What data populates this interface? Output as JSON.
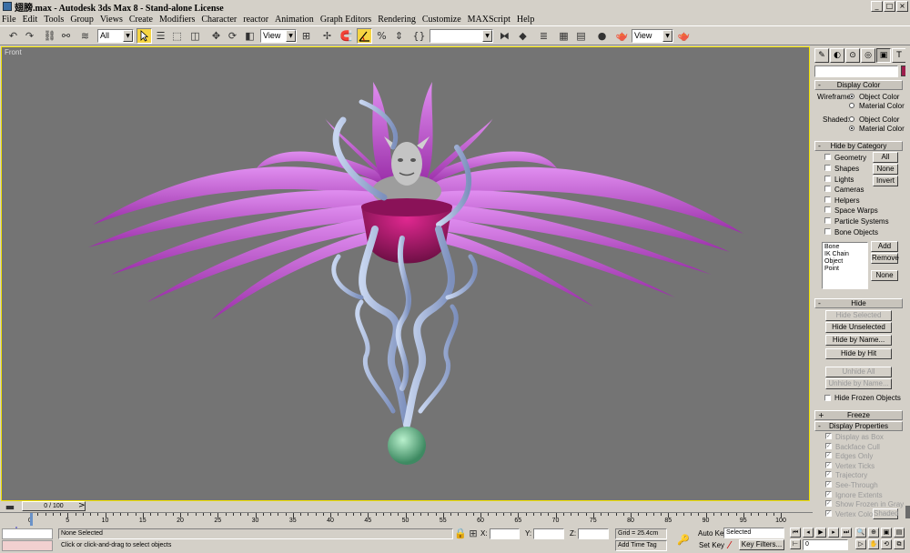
{
  "title_bar": {
    "title": "翅膀.max - Autodesk 3ds Max 8 - Stand-alone License",
    "buttons": [
      "_",
      "□",
      "×"
    ]
  },
  "menu": [
    "File",
    "Edit",
    "Tools",
    "Group",
    "Views",
    "Create",
    "Modifiers",
    "Character",
    "reactor",
    "Animation",
    "Graph Editors",
    "Rendering",
    "Customize",
    "MAXScript",
    "Help"
  ],
  "toolbar": {
    "selection_filter": "All",
    "ref_coord": "View",
    "named_selection": "",
    "view_dropdown": "View"
  },
  "viewport": {
    "label": "Front",
    "border_color": "#f2e200",
    "background": "#747474"
  },
  "command_panel": {
    "object_color": "#9e1e4c",
    "display_color": {
      "title": "Display Color",
      "wireframe_label": "Wireframe:",
      "shaded_label": "Shaded:",
      "object_color": "Object Color",
      "material_color": "Material Color"
    },
    "hide_by_category": {
      "title": "Hide by Category",
      "items": [
        "Geometry",
        "Shapes",
        "Lights",
        "Cameras",
        "Helpers",
        "Space Warps",
        "Particle Systems",
        "Bone Objects"
      ],
      "all": "All",
      "none": "None",
      "invert": "Invert",
      "list": [
        "Bone",
        "IK Chain Object",
        "Point"
      ],
      "add": "Add",
      "remove": "Remove",
      "none2": "None"
    },
    "hide": {
      "title": "Hide",
      "hide_selected": "Hide Selected",
      "hide_unselected": "Hide Unselected",
      "hide_by_name": "Hide by Name...",
      "hide_by_hit": "Hide by Hit",
      "unhide_all": "Unhide All",
      "unhide_by_name": "Unhide by Name...",
      "hide_frozen": "Hide Frozen Objects"
    },
    "freeze": {
      "title": "Freeze"
    },
    "display_properties": {
      "title": "Display Properties",
      "items": [
        "Display as Box",
        "Backface Cull",
        "Edges Only",
        "Vertex Ticks",
        "Trajectory",
        "See-Through",
        "Ignore Extents",
        "Show Frozen in Gray",
        "Vertex Colors"
      ],
      "shaded": "Shaded"
    }
  },
  "time": {
    "slider": "0 / 100",
    "ticks": [
      "0",
      "5",
      "10",
      "15",
      "20",
      "25",
      "30",
      "35",
      "40",
      "45",
      "50",
      "55",
      "60",
      "65",
      "70",
      "75",
      "80",
      "85",
      "90",
      "95",
      "100"
    ]
  },
  "status": {
    "selection": "None Selected",
    "prompt": "Click or click-and-drag to select objects",
    "x_label": "X:",
    "y_label": "Y:",
    "z_label": "Z:",
    "grid": "Grid = 25.4cm",
    "add_time_tag": "Add Time Tag",
    "auto_key": "Auto Key",
    "set_key": "Set Key",
    "key_mode": "Selected",
    "key_filters": "Key Filters...",
    "frame": "0"
  }
}
